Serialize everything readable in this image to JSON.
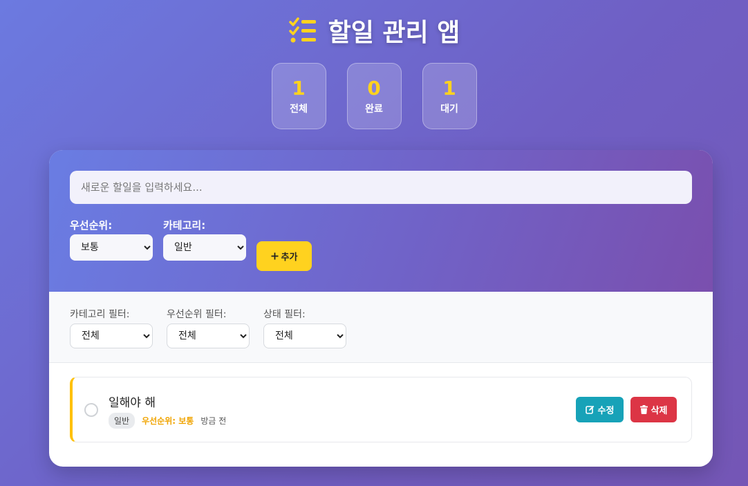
{
  "header": {
    "title": "할일 관리 앱",
    "icon": "checklist-icon"
  },
  "stats": [
    {
      "value": "1",
      "label": "전체"
    },
    {
      "value": "0",
      "label": "완료"
    },
    {
      "value": "1",
      "label": "대기"
    }
  ],
  "form": {
    "input_placeholder": "새로운 할일을 입력하세요...",
    "priority_label": "우선순위:",
    "priority_value": "보통",
    "category_label": "카테고리:",
    "category_value": "일반",
    "add_label": "추가",
    "add_icon": "plus-icon"
  },
  "filters": {
    "category_label": "카테고리 필터:",
    "category_value": "전체",
    "priority_label": "우선순위 필터:",
    "priority_value": "전체",
    "status_label": "상태 필터:",
    "status_value": "전체"
  },
  "todos": [
    {
      "text": "일해야 해",
      "category": "일반",
      "priority": "우선순위: 보통",
      "time": "방금 전",
      "edit_label": "수정",
      "delete_label": "삭제"
    }
  ],
  "colors": {
    "accent_yellow": "#ffd21f",
    "edit": "#17a2b8",
    "delete": "#dc3545",
    "priority_medium": "#ffc107"
  }
}
